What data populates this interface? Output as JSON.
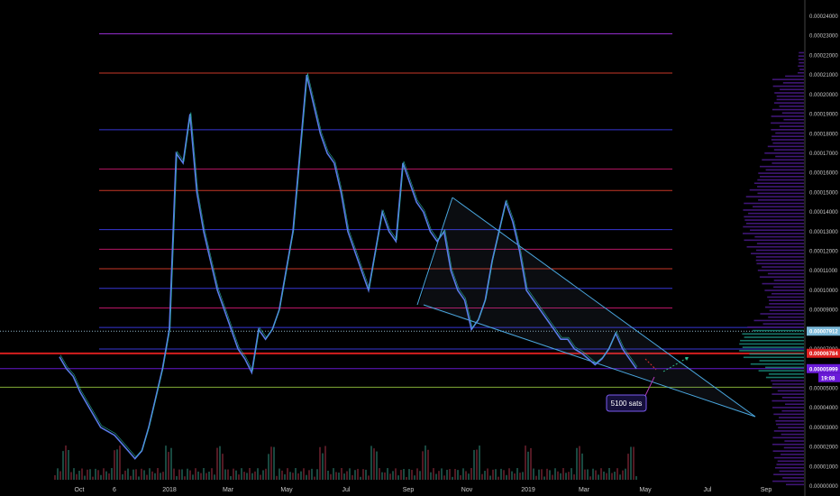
{
  "chart_data": {
    "type": "line",
    "y_ticks": [
      "0.00024000",
      "0.00023000",
      "0.00022000",
      "0.00021000",
      "0.00020000",
      "0.00019000",
      "0.00018000",
      "0.00017000",
      "0.00016000",
      "0.00015000",
      "0.00014000",
      "0.00013000",
      "0.00012000",
      "0.00011000",
      "0.00010000",
      "0.00009000",
      "0.00008000",
      "0.00007000",
      "0.00006000",
      "0.00005000",
      "0.00004000",
      "0.00003000",
      "0.00002000",
      "0.00001000",
      "0.00000000"
    ],
    "x_ticks": [
      "Oct",
      "6",
      "2018",
      "Mar",
      "May",
      "Jul",
      "Sep",
      "Nov",
      "2019",
      "Mar",
      "May",
      "Jul",
      "Sep"
    ],
    "ylim": [
      0,
      0.000245
    ],
    "series": [
      {
        "values": [
          6.6e-05,
          6e-05,
          5.6e-05,
          4.8e-05,
          4.2e-05,
          3.6e-05,
          3e-05,
          2.8e-05,
          2.6e-05,
          2.2e-05,
          1.8e-05,
          1.4e-05,
          1.8e-05,
          3e-05,
          4.5e-05,
          6e-05,
          8e-05,
          0.00017,
          0.000165,
          0.00019,
          0.00015,
          0.00013,
          0.000115,
          0.0001,
          9e-05,
          8e-05,
          7e-05,
          6.5e-05,
          5.8e-05,
          8e-05,
          7.5e-05,
          8e-05,
          9e-05,
          0.00011,
          0.00013,
          0.00017,
          0.00021,
          0.000195,
          0.00018,
          0.00017,
          0.000165,
          0.00015,
          0.00013,
          0.00012,
          0.00011,
          0.0001,
          0.00012,
          0.00014,
          0.00013,
          0.000125,
          0.000165,
          0.000155,
          0.000145,
          0.00014,
          0.00013,
          0.000125,
          0.00013,
          0.00011,
          0.0001,
          9.5e-05,
          8e-05,
          8.5e-05,
          9.5e-05,
          0.000115,
          0.00013,
          0.000145,
          0.000135,
          0.00012,
          0.0001,
          9.5e-05,
          9e-05,
          8.5e-05,
          8e-05,
          7.5e-05,
          7.5e-05,
          7e-05,
          6.8e-05,
          6.5e-05,
          6.2e-05,
          6.5e-05,
          7e-05,
          7.8e-05,
          7e-05,
          6.5e-05,
          6e-05
        ]
      }
    ],
    "annotations": {
      "callout": "5100 sats",
      "price_tags": [
        {
          "label": "0.00007912",
          "color": "#7ab8d8",
          "value": 7.912e-05
        },
        {
          "label": "0.00006784",
          "color": "#e02020",
          "value": 6.784e-05
        },
        {
          "label": "0.00005999",
          "color": "#6a1ad8",
          "value": 5.999e-05
        }
      ],
      "countdown": "19:08"
    },
    "levels": [
      {
        "value": 0.000231,
        "color": "#9b2fd6"
      },
      {
        "value": 0.000211,
        "color": "#d23a2a"
      },
      {
        "value": 0.000182,
        "color": "#3a3ae0"
      },
      {
        "value": 0.000162,
        "color": "#c2186b"
      },
      {
        "value": 0.000151,
        "color": "#d23a2a"
      },
      {
        "value": 0.000131,
        "color": "#3a3ae0"
      },
      {
        "value": 0.000121,
        "color": "#c2186b"
      },
      {
        "value": 0.000111,
        "color": "#d23a2a"
      },
      {
        "value": 0.000101,
        "color": "#3a3ae0"
      },
      {
        "value": 9.1e-05,
        "color": "#c2186b"
      },
      {
        "value": 8.1e-05,
        "color": "#3a3ae0"
      },
      {
        "value": 7e-05,
        "color": "#3a3ae0"
      },
      {
        "value": 6.78e-05,
        "color": "#e02020"
      },
      {
        "value": 6e-05,
        "color": "#6a1ad8"
      },
      {
        "value": 5.05e-05,
        "color": "#8ab83a"
      }
    ],
    "grid": false,
    "legend": "none"
  }
}
